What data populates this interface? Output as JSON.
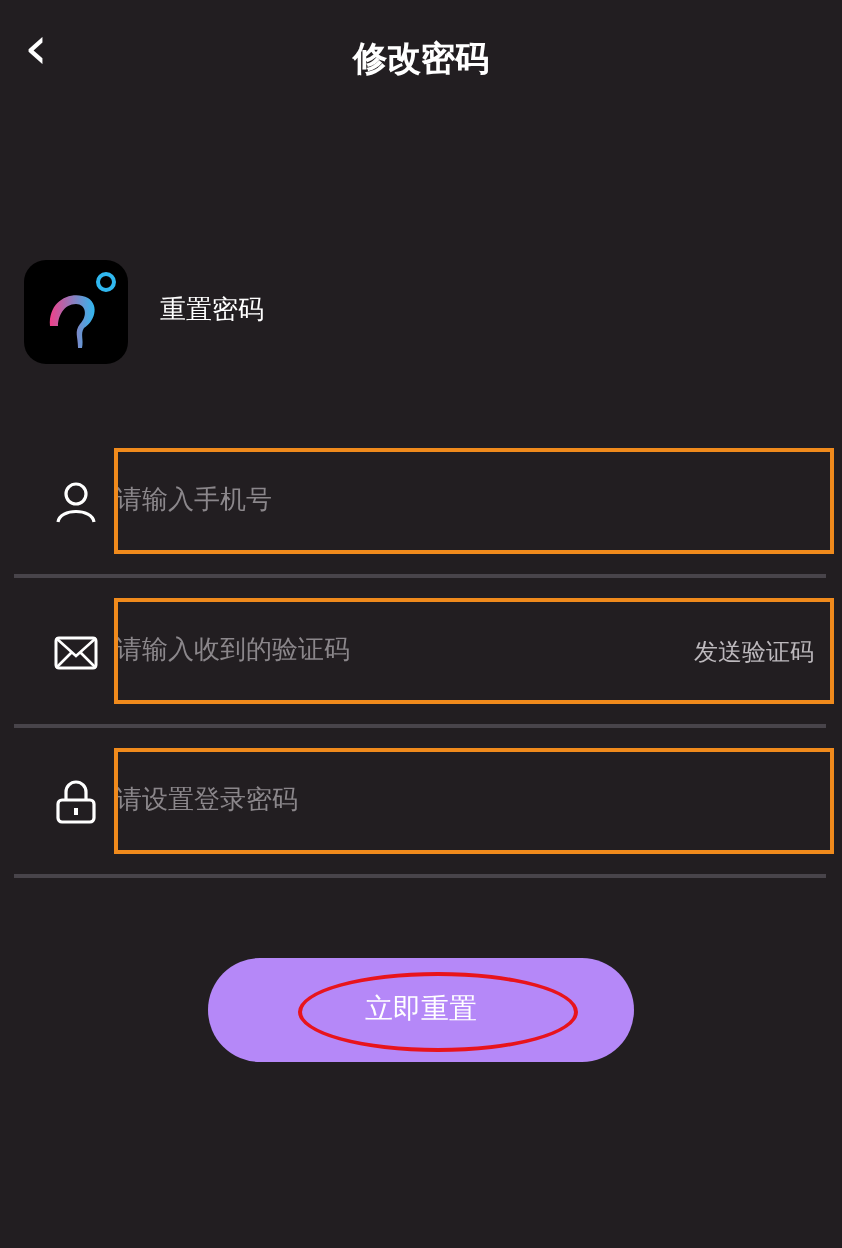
{
  "header": {
    "back": "‹",
    "title": "修改密码"
  },
  "app": {
    "label": "重置密码"
  },
  "fields": [
    {
      "kind": "phone",
      "placeholder": "请输入手机号",
      "highlighted": true
    },
    {
      "kind": "code",
      "placeholder": "请输入收到的验证码",
      "action": "发送验证码",
      "highlighted": true
    },
    {
      "kind": "password",
      "placeholder": "请设置登录密码",
      "highlighted": true
    }
  ],
  "submit": {
    "label": "立即重置",
    "circled": true
  }
}
